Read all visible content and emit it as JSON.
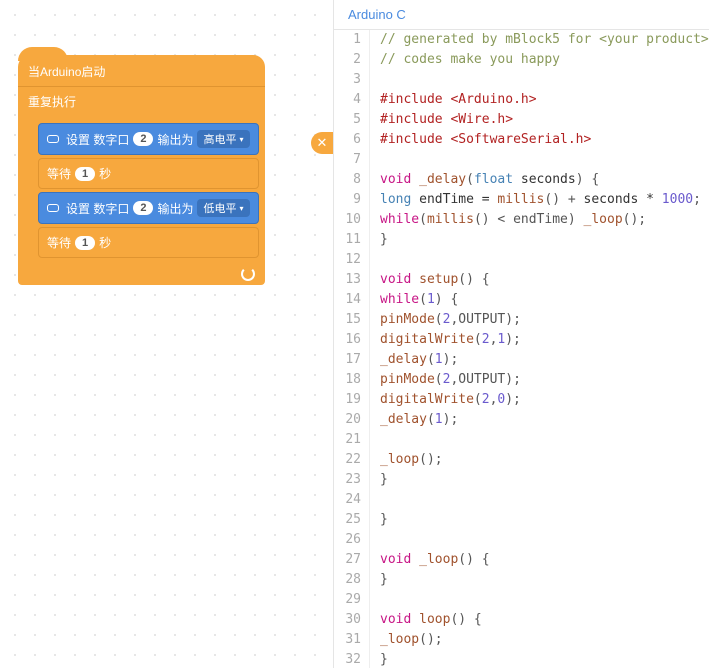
{
  "blocks": {
    "hat_label": "当Arduino启动",
    "forever_label": "重复执行",
    "digital1_prefix": "设置 数字口",
    "digital1_pin": "2",
    "digital1_mid": "输出为",
    "digital1_level": "高电平",
    "wait1_prefix": "等待",
    "wait1_val": "1",
    "wait1_suffix": "秒",
    "digital2_prefix": "设置 数字口",
    "digital2_pin": "2",
    "digital2_mid": "输出为",
    "digital2_level": "低电平",
    "wait2_prefix": "等待",
    "wait2_val": "1",
    "wait2_suffix": "秒"
  },
  "close_icon": "✕",
  "tab_label": "Arduino C",
  "code": {
    "l1": "// generated by mBlock5 for <your product>",
    "l2": "// codes make you happy",
    "l4_pp": "#include ",
    "l4_h": "<Arduino.h>",
    "l5_pp": "#include ",
    "l5_h": "<Wire.h>",
    "l6_pp": "#include ",
    "l6_h": "<SoftwareSerial.h>",
    "l8_kw": "void",
    "l8_fn": " _delay",
    "l8_p1": "(",
    "l8_ty": "float",
    "l8_id": " seconds",
    "l8_p2": ") {",
    "l9_ind": "    ",
    "l9_ty": "long",
    "l9_id": " endTime = ",
    "l9_fn1": "millis",
    "l9_p1": "() + ",
    "l9_id2": "seconds * ",
    "l9_nm": "1000",
    "l9_p2": ";",
    "l10_ind": "    ",
    "l10_kw": "while",
    "l10_p1": "(",
    "l10_fn": "millis",
    "l10_p2": "() < endTime) ",
    "l10_fn2": "_loop",
    "l10_p3": "();",
    "l11": "}",
    "l13_kw": "void",
    "l13_fn": " setup",
    "l13_p": "() {",
    "l14_ind": "    ",
    "l14_kw": "while",
    "l14_p1": "(",
    "l14_nm": "1",
    "l14_p2": ") {",
    "l15_ind": "        ",
    "l15_fn": "pinMode",
    "l15_p1": "(",
    "l15_nm": "2",
    "l15_p2": ",OUTPUT);",
    "l16_ind": "        ",
    "l16_fn": "digitalWrite",
    "l16_p1": "(",
    "l16_nm1": "2",
    "l16_c": ",",
    "l16_nm2": "1",
    "l16_p2": ");",
    "l17_ind": "        ",
    "l17_fn": "_delay",
    "l17_p1": "(",
    "l17_nm": "1",
    "l17_p2": ");",
    "l18_ind": "        ",
    "l18_fn": "pinMode",
    "l18_p1": "(",
    "l18_nm": "2",
    "l18_p2": ",OUTPUT);",
    "l19_ind": "        ",
    "l19_fn": "digitalWrite",
    "l19_p1": "(",
    "l19_nm1": "2",
    "l19_c": ",",
    "l19_nm2": "0",
    "l19_p2": ");",
    "l20_ind": "        ",
    "l20_fn": "_delay",
    "l20_p1": "(",
    "l20_nm": "1",
    "l20_p2": ");",
    "l22_ind": "        ",
    "l22_fn": "_loop",
    "l22_p": "();",
    "l23": "    }",
    "l25": "}",
    "l27_kw": "void",
    "l27_fn": " _loop",
    "l27_p": "() {",
    "l28": "}",
    "l30_kw": "void",
    "l30_fn": " loop",
    "l30_p": "() {",
    "l31_ind": "    ",
    "l31_fn": "_loop",
    "l31_p": "();",
    "l32": "}"
  },
  "linecount": 32
}
